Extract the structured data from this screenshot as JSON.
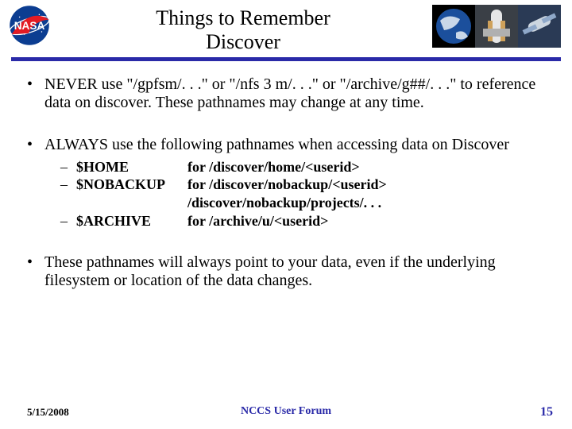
{
  "header": {
    "title_line1": "Things to Remember",
    "title_line2": "Discover"
  },
  "bullets": {
    "b1_text": "NEVER use \"/gpfsm/. . .\"  or  \"/nfs 3 m/. . .\"  or  \"/archive/g##/. . .\" to reference data on discover.  These pathnames may change at any time.",
    "b2_text": "ALWAYS use the following pathnames when accessing data on Discover",
    "b3_text": "These pathnames will always point to your data, even if the underlying filesystem or location of the data changes."
  },
  "paths": {
    "r1_var": "$HOME",
    "r1_path": "for   /discover/home/<userid>",
    "r2_var": "$NOBACKUP",
    "r2_path": "for   /discover/nobackup/<userid>",
    "r3_path": "/discover/nobackup/projects/. . .",
    "r4_var": "$ARCHIVE",
    "r4_path": "for   /archive/u/<userid>"
  },
  "footer": {
    "date": "5/15/2008",
    "center": "NCCS User Forum",
    "page": "15"
  }
}
